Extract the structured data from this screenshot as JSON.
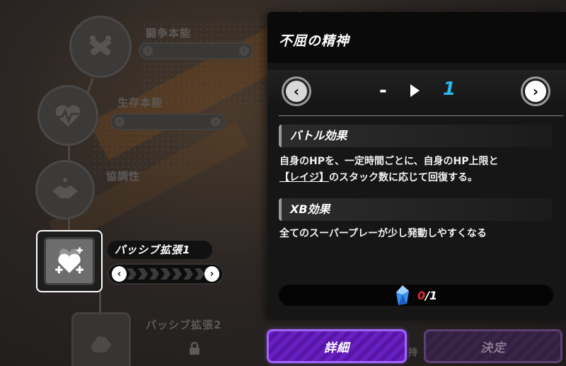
{
  "skill_tree": {
    "nodes": [
      {
        "label": "闘争本能",
        "icon": "crossed-arms-icon"
      },
      {
        "label": "生存本能",
        "icon": "heart-pulse-icon"
      },
      {
        "label": "協調性",
        "icon": "handshake-icon"
      }
    ],
    "active_node": {
      "label": "パッシブ拡張1",
      "icon": "heart-plus-icon",
      "progress_label_left": "‹",
      "progress_label_right": "›"
    },
    "locked_node": {
      "label": "パッシブ拡張2",
      "icon": "fist-icon",
      "lock_icon": "lock-icon"
    }
  },
  "panel": {
    "title": "不屈の精神",
    "level": {
      "prev_arrow": "‹",
      "next_arrow": "›",
      "current": "-",
      "next": "1"
    },
    "battle_effect": {
      "heading": "バトル効果",
      "line1": "自身のHPを、一定時間ごとに、自身のHP上限と",
      "line2_bracket": "【レイジ】",
      "line2_rest": "のスタック数に応じて回復する。"
    },
    "xb_effect": {
      "heading": "XB効果",
      "text": "全てのスーパープレーが少し発動しやすくなる"
    },
    "cost": {
      "icon": "crystal-icon",
      "have": "0",
      "separator": "/",
      "need": "1"
    }
  },
  "buttons": {
    "detail": "詳細",
    "confirm": "決定"
  },
  "background_text": "持",
  "colors": {
    "accent_purple": "#6a1fc2",
    "level_blue": "#2bb8f0",
    "cost_red": "#e0283a"
  }
}
